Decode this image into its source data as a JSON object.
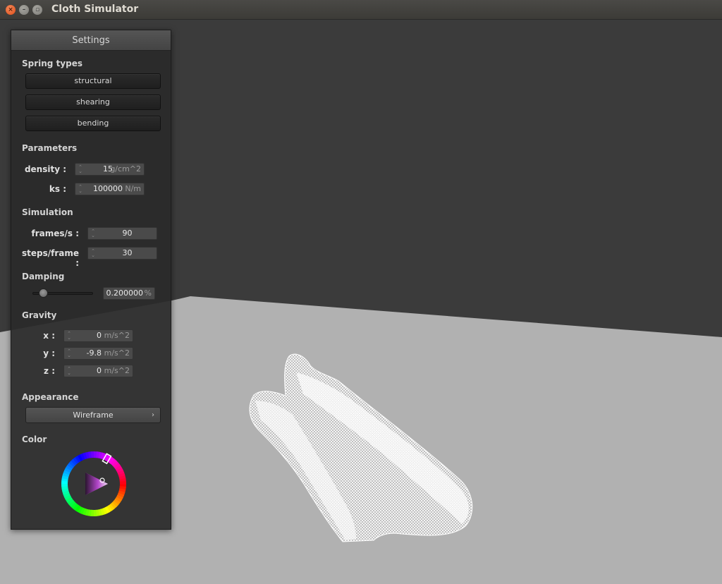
{
  "window": {
    "title": "Cloth Simulator"
  },
  "panel": {
    "title": "Settings",
    "spring_types": {
      "heading": "Spring types",
      "buttons": [
        "structural",
        "shearing",
        "bending"
      ]
    },
    "parameters": {
      "heading": "Parameters",
      "density": {
        "label": "density :",
        "value": "15",
        "unit": "g/cm^2"
      },
      "ks": {
        "label": "ks :",
        "value": "100000",
        "unit": "N/m"
      }
    },
    "simulation": {
      "heading": "Simulation",
      "fps": {
        "label": "frames/s :",
        "value": "90"
      },
      "steps": {
        "label": "steps/frame :",
        "value": "30"
      }
    },
    "damping": {
      "heading": "Damping",
      "slider_fraction": 0.2,
      "value": "0.200000",
      "unit": "%"
    },
    "gravity": {
      "heading": "Gravity",
      "x": {
        "label": "x :",
        "value": "0",
        "unit": "m/s^2"
      },
      "y": {
        "label": "y :",
        "value": "-9.8",
        "unit": "m/s^2"
      },
      "z": {
        "label": "z :",
        "value": "0",
        "unit": "m/s^2"
      }
    },
    "appearance": {
      "heading": "Appearance",
      "selected": "Wireframe"
    },
    "color": {
      "heading": "Color",
      "selected_color": "#ffffff"
    }
  },
  "colors": {
    "background": "#3b3b3b",
    "floor": "#b1b1b1",
    "cloth": "#ffffff"
  }
}
